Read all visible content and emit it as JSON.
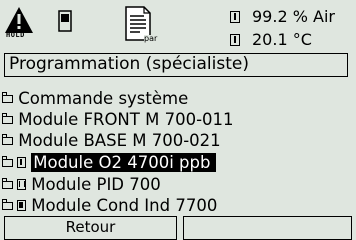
{
  "status": {
    "hold_label": "HOLD",
    "reading1": "99.2 % Air",
    "reading2": "20.1 °C",
    "doc_label": "par"
  },
  "title": "Programmation (spécialiste)",
  "menu": {
    "items": [
      {
        "label": "Commande système"
      },
      {
        "label": "Module FRONT M 700-011"
      },
      {
        "label": "Module BASE M 700-021"
      },
      {
        "label": "Module O2 4700i ppb"
      },
      {
        "label": "Module PID 700"
      },
      {
        "label": "Module  Cond Ind 7700"
      }
    ],
    "selected_index": 3
  },
  "softkeys": {
    "left": "Retour",
    "right": ""
  }
}
